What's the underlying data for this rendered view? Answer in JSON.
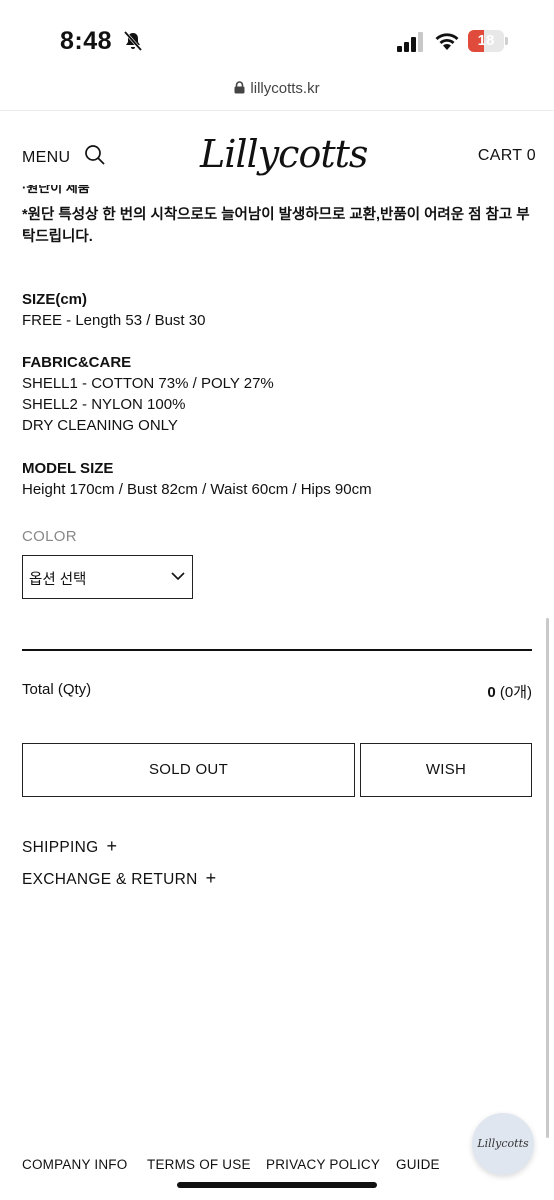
{
  "status": {
    "time": "8:48",
    "battery": "18"
  },
  "browser": {
    "url": "lillycotts.kr"
  },
  "header": {
    "menu": "MENU",
    "logo": "Lillycotts",
    "cart": "CART 0"
  },
  "content": {
    "cut_line": "·원단이 제품",
    "notice": "*원단 특성상 한 번의 시착으로도 늘어남이 발생하므로 교환,반품이 어려운 점 참고 부탁드립니다.",
    "size": {
      "heading": "SIZE(cm)",
      "lines": [
        "FREE - Length 53 / Bust 30"
      ]
    },
    "fabric": {
      "heading": "FABRIC&CARE",
      "lines": [
        "SHELL1 - COTTON 73% / POLY 27%",
        "SHELL2 - NYLON 100%",
        "DRY CLEANING ONLY"
      ]
    },
    "model": {
      "heading": "MODEL SIZE",
      "lines": [
        "Height 170cm / Bust 82cm / Waist 60cm / Hips 90cm"
      ]
    }
  },
  "option": {
    "label": "COLOR",
    "selected": "옵션 선택"
  },
  "total": {
    "label": "Total (Qty)",
    "amount": "0",
    "qty": "(0개)"
  },
  "buttons": {
    "sold_out": "SOLD OUT",
    "wish": "WISH"
  },
  "accordions": {
    "shipping": "SHIPPING",
    "exchange": "EXCHANGE & RETURN",
    "plus": "+"
  },
  "footer": {
    "company": "COMPANY INFO",
    "terms": "TERMS OF USE",
    "privacy": "PRIVACY POLICY",
    "guide": "GUIDE"
  },
  "fab": {
    "label": "Lillycotts"
  },
  "icons": [
    "bell-slash-icon",
    "signal-icon",
    "wifi-icon",
    "battery-icon",
    "lock-icon",
    "search-icon",
    "chevron-down-icon"
  ]
}
